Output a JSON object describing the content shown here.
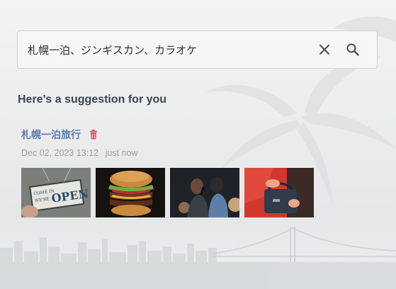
{
  "search": {
    "value": "札幌一泊、ジンギスカン、カラオケ",
    "clear_icon": "close-icon",
    "search_icon": "search-icon"
  },
  "section": {
    "heading": "Here's a suggestion for you"
  },
  "suggestion": {
    "title": "札幌一泊旅行",
    "date": "Dec 02, 2023 13:12",
    "ago": "just now",
    "delete_icon": "trash-icon",
    "images": [
      {
        "name": "open-sign-image"
      },
      {
        "name": "burger-image"
      },
      {
        "name": "karaoke-image"
      },
      {
        "name": "handbag-image"
      }
    ]
  },
  "colors": {
    "title_link": "#5e77b4",
    "delete_icon": "#e05a6a",
    "heading": "#3a4652"
  }
}
